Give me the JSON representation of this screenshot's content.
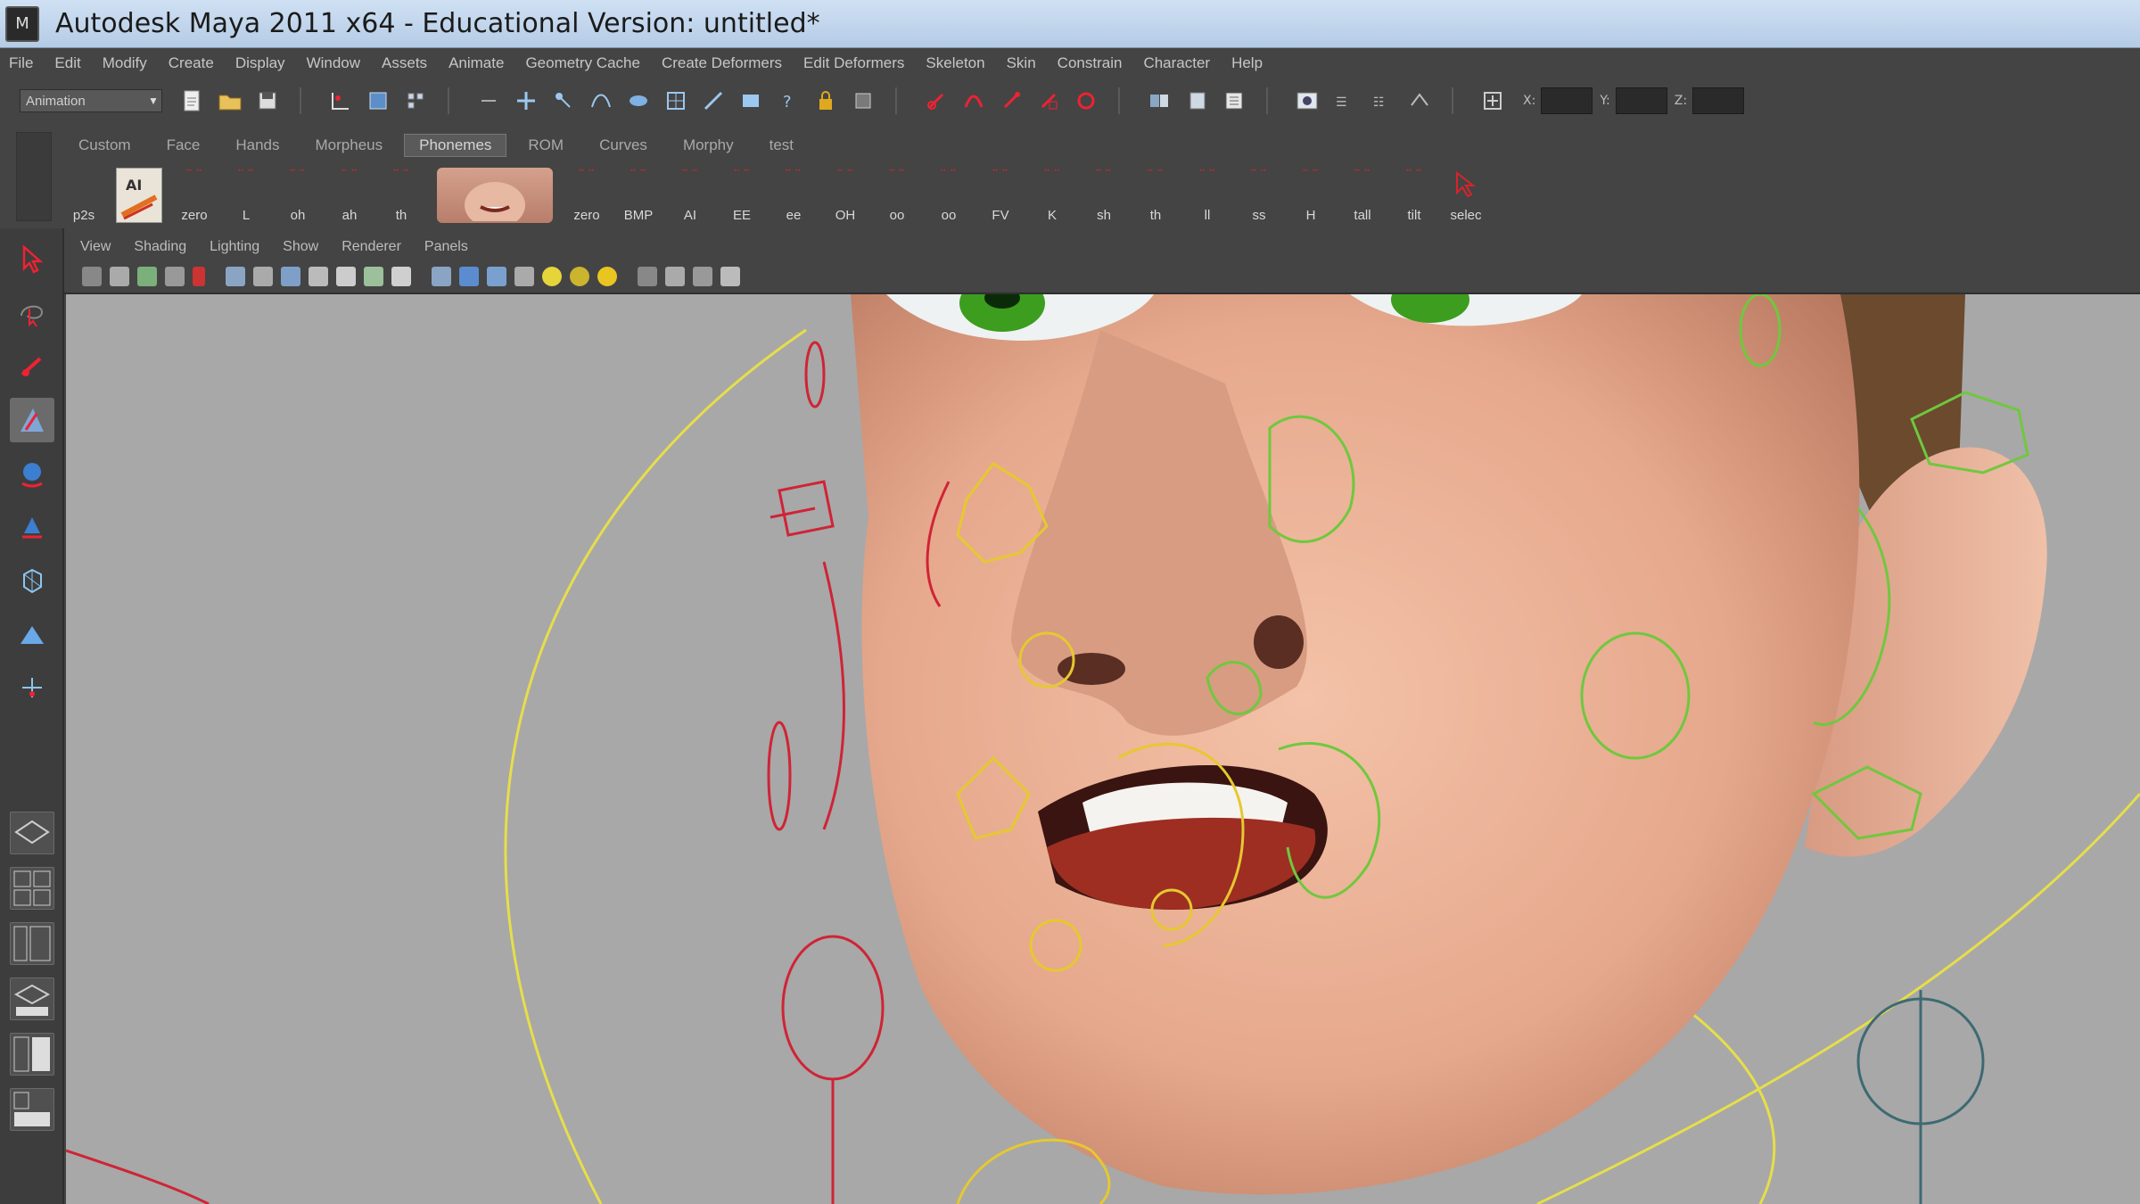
{
  "window": {
    "title": "Autodesk Maya 2011 x64 - Educational Version: untitled*",
    "icon": "maya-app-icon"
  },
  "menubar": {
    "items": [
      "File",
      "Edit",
      "Modify",
      "Create",
      "Display",
      "Window",
      "Assets",
      "Animate",
      "Geometry Cache",
      "Create Deformers",
      "Edit Deformers",
      "Skeleton",
      "Skin",
      "Constrain",
      "Character",
      "Help"
    ]
  },
  "statusline": {
    "menu_set": "Animation",
    "x_label": "X:",
    "y_label": "Y:",
    "z_label": "Z:",
    "x_value": "",
    "y_value": "",
    "z_value": ""
  },
  "shelf": {
    "tabs": [
      "Custom",
      "Face",
      "Hands",
      "Morpheus",
      "Phonemes",
      "ROM",
      "Curves",
      "Morphy",
      "test"
    ],
    "active_tab": "Phonemes",
    "items": [
      "p2s",
      "zero",
      "L",
      "oh",
      "ah",
      "th",
      "zero",
      "BMP",
      "AI",
      "EE",
      "ee",
      "OH",
      "oo",
      "oo",
      "FV",
      "K",
      "sh",
      "th",
      "ll",
      "ss",
      "H",
      "tall",
      "tilt",
      "selec"
    ]
  },
  "panel": {
    "menu": [
      "View",
      "Shading",
      "Lighting",
      "Show",
      "Renderer",
      "Panels"
    ]
  },
  "colors": {
    "accent_red": "#d9232b",
    "control_yellow": "#e6c830",
    "control_green": "#5fc040",
    "viewport_bg": "#a8a8a8",
    "ui_bg": "#444444"
  }
}
